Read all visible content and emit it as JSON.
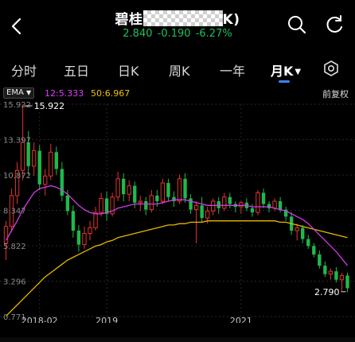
{
  "header": {
    "title_prefix": "碧桂",
    "title_suffix": "K)",
    "price": "2.840",
    "change": "-0.190",
    "change_pct": "-6.27%",
    "change_color": "#1fbf5f"
  },
  "tabs": [
    {
      "label": "分时"
    },
    {
      "label": "五日"
    },
    {
      "label": "日K"
    },
    {
      "label": "周K"
    },
    {
      "label": "一年"
    },
    {
      "label": "月K"
    }
  ],
  "indicator": {
    "ema_label": "EMA",
    "ma12": "12:5.333",
    "ma50": "50:6.967",
    "restore_label": "前复权"
  },
  "chart_data": {
    "type": "candlestick",
    "y_ticks": [
      "15.922",
      "13.397",
      "10.872",
      "8.347",
      "5.822",
      "3.296",
      "0.771"
    ],
    "x_ticks": [
      "2018-02",
      "2019",
      "2021"
    ],
    "high_label": "15.922",
    "last_label": "2.790",
    "ylim": [
      0.771,
      15.922
    ],
    "colors": {
      "up": "#e4342f",
      "down": "#1fb84c",
      "ma12": "#d33ce6",
      "ma50": "#e6b800"
    },
    "candles": [
      [
        6.0,
        7.6,
        4.8,
        7.2
      ],
      [
        7.2,
        9.9,
        6.8,
        9.4
      ],
      [
        9.4,
        11.8,
        8.8,
        11.2
      ],
      [
        11.2,
        15.9,
        10.5,
        13.2
      ],
      [
        13.2,
        14.0,
        10.9,
        11.5
      ],
      [
        11.5,
        13.2,
        10.8,
        12.6
      ],
      [
        12.6,
        13.0,
        9.8,
        10.2
      ],
      [
        10.2,
        11.3,
        9.4,
        10.8
      ],
      [
        10.8,
        13.1,
        10.5,
        12.5
      ],
      [
        12.5,
        12.9,
        10.9,
        11.3
      ],
      [
        11.3,
        11.8,
        9.0,
        9.4
      ],
      [
        9.4,
        9.8,
        8.0,
        8.3
      ],
      [
        8.3,
        8.7,
        6.4,
        6.9
      ],
      [
        6.9,
        7.3,
        5.4,
        5.9
      ],
      [
        5.9,
        7.2,
        5.6,
        6.7
      ],
      [
        6.7,
        7.6,
        6.2,
        7.1
      ],
      [
        7.1,
        8.6,
        6.9,
        8.2
      ],
      [
        8.2,
        9.6,
        7.9,
        9.2
      ],
      [
        9.2,
        9.7,
        7.6,
        8.1
      ],
      [
        8.1,
        9.6,
        7.9,
        9.3
      ],
      [
        9.3,
        11.1,
        9.0,
        10.6
      ],
      [
        10.6,
        11.0,
        9.0,
        9.5
      ],
      [
        9.5,
        10.5,
        9.0,
        10.1
      ],
      [
        10.1,
        10.4,
        8.5,
        8.9
      ],
      [
        8.9,
        9.4,
        8.3,
        9.0
      ],
      [
        9.0,
        9.3,
        8.0,
        8.4
      ],
      [
        8.4,
        9.8,
        8.2,
        9.4
      ],
      [
        9.4,
        9.8,
        8.6,
        9.0
      ],
      [
        9.0,
        10.6,
        8.8,
        10.3
      ],
      [
        10.3,
        10.6,
        9.0,
        9.3
      ],
      [
        9.3,
        9.7,
        8.6,
        9.0
      ],
      [
        9.0,
        10.9,
        8.8,
        10.6
      ],
      [
        10.6,
        11.0,
        8.9,
        9.2
      ],
      [
        9.2,
        9.5,
        8.1,
        8.4
      ],
      [
        8.4,
        9.0,
        6.0,
        8.7
      ],
      [
        8.7,
        9.3,
        7.5,
        7.8
      ],
      [
        7.8,
        8.6,
        7.4,
        8.3
      ],
      [
        8.3,
        9.2,
        8.0,
        9.0
      ],
      [
        9.0,
        9.3,
        8.1,
        8.5
      ],
      [
        8.5,
        9.6,
        8.3,
        9.3
      ],
      [
        9.3,
        9.6,
        8.5,
        8.8
      ],
      [
        8.8,
        9.0,
        8.2,
        8.6
      ],
      [
        8.6,
        9.0,
        8.1,
        8.9
      ],
      [
        8.9,
        9.2,
        8.3,
        8.5
      ],
      [
        8.5,
        8.8,
        7.9,
        8.2
      ],
      [
        8.2,
        9.8,
        8.0,
        9.6
      ],
      [
        9.6,
        9.9,
        8.5,
        8.8
      ],
      [
        8.8,
        9.0,
        8.2,
        8.5
      ],
      [
        8.5,
        9.2,
        8.3,
        9.0
      ],
      [
        9.0,
        9.3,
        8.2,
        8.4
      ],
      [
        8.4,
        8.6,
        7.6,
        7.9
      ],
      [
        7.9,
        8.2,
        6.6,
        6.9
      ],
      [
        6.9,
        7.4,
        6.2,
        7.1
      ],
      [
        7.1,
        7.3,
        6.0,
        6.3
      ],
      [
        6.3,
        6.6,
        5.6,
        5.8
      ],
      [
        5.8,
        6.0,
        5.0,
        5.2
      ],
      [
        5.2,
        5.5,
        4.2,
        4.4
      ],
      [
        4.4,
        4.7,
        3.6,
        3.8
      ],
      [
        3.8,
        4.2,
        3.4,
        4.0
      ],
      [
        4.0,
        4.3,
        3.2,
        3.4
      ],
      [
        3.4,
        3.9,
        2.6,
        3.7
      ],
      [
        3.7,
        3.9,
        2.5,
        2.79
      ]
    ],
    "ma12": [
      6.2,
      6.9,
      7.6,
      8.4,
      9.0,
      9.6,
      9.9,
      10.0,
      10.1,
      10.0,
      9.8,
      9.5,
      9.1,
      8.7,
      8.4,
      8.2,
      8.1,
      8.1,
      8.2,
      8.3,
      8.5,
      8.6,
      8.7,
      8.8,
      8.8,
      8.8,
      8.8,
      8.8,
      8.9,
      9.0,
      9.1,
      9.1,
      9.1,
      9.0,
      8.9,
      8.8,
      8.7,
      8.7,
      8.7,
      8.7,
      8.7,
      8.7,
      8.7,
      8.7,
      8.6,
      8.6,
      8.6,
      8.6,
      8.5,
      8.4,
      8.3,
      8.1,
      7.9,
      7.7,
      7.4,
      7.0,
      6.6,
      6.2,
      5.8,
      5.4,
      4.9,
      4.4
    ],
    "ma50": [
      0.8,
      1.2,
      1.6,
      2.0,
      2.4,
      2.8,
      3.2,
      3.6,
      3.9,
      4.2,
      4.5,
      4.8,
      5.0,
      5.2,
      5.4,
      5.6,
      5.8,
      5.9,
      6.1,
      6.2,
      6.4,
      6.5,
      6.6,
      6.7,
      6.8,
      6.9,
      7.0,
      7.1,
      7.2,
      7.3,
      7.3,
      7.4,
      7.4,
      7.5,
      7.5,
      7.5,
      7.6,
      7.6,
      7.6,
      7.6,
      7.6,
      7.6,
      7.6,
      7.6,
      7.6,
      7.6,
      7.6,
      7.6,
      7.6,
      7.5,
      7.5,
      7.4,
      7.3,
      7.2,
      7.1,
      7.0,
      6.9,
      6.8,
      6.7,
      6.6,
      6.5,
      6.4
    ]
  }
}
